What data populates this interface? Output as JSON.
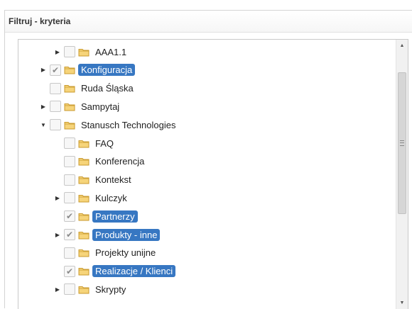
{
  "panel": {
    "title": "Filtruj - kryteria"
  },
  "icons": {
    "folder": "folder-icon",
    "expand": "triangle-right-icon",
    "collapse": "triangle-down-icon",
    "check": "checkmark-icon"
  },
  "colors": {
    "selection": "#3777c2",
    "folder": "#f0c15a"
  },
  "tree": [
    {
      "label": "AAA1.1",
      "toggle": "expand",
      "checked": false,
      "selected": false
    },
    {
      "label": "Konfiguracja",
      "toggle": "expand",
      "checked": true,
      "selected": true
    },
    {
      "label": "Ruda Śląska",
      "toggle": "",
      "checked": false,
      "selected": false
    },
    {
      "label": "Sampytaj",
      "toggle": "expand",
      "checked": false,
      "selected": false
    },
    {
      "label": "Stanusch Technologies",
      "toggle": "collapse",
      "checked": false,
      "selected": false
    },
    {
      "label": "FAQ",
      "toggle": "",
      "checked": false,
      "selected": false
    },
    {
      "label": "Konferencja",
      "toggle": "",
      "checked": false,
      "selected": false
    },
    {
      "label": "Kontekst",
      "toggle": "",
      "checked": false,
      "selected": false
    },
    {
      "label": "Kulczyk",
      "toggle": "expand",
      "checked": false,
      "selected": false
    },
    {
      "label": "Partnerzy",
      "toggle": "",
      "checked": true,
      "selected": true
    },
    {
      "label": "Produkty - inne",
      "toggle": "expand",
      "checked": true,
      "selected": true
    },
    {
      "label": "Projekty unijne",
      "toggle": "",
      "checked": false,
      "selected": false
    },
    {
      "label": "Realizacje / Klienci",
      "toggle": "",
      "checked": true,
      "selected": true
    },
    {
      "label": "Skrypty",
      "toggle": "expand",
      "checked": false,
      "selected": false
    }
  ]
}
